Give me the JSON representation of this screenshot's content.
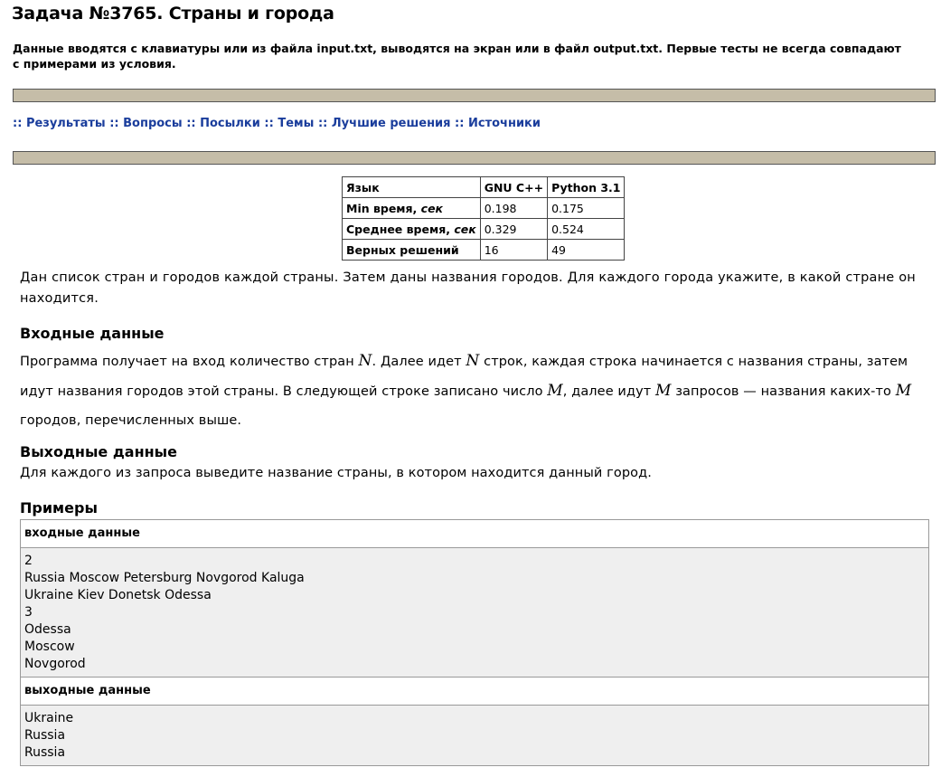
{
  "page": {
    "title": "Задача №3765. Страны и города",
    "note": "Данные вводятся с клавиатуры или из файла input.txt, выводятся на экран или в файл output.txt. Первые тесты не всегда совпадают с примерами из условия."
  },
  "nav": {
    "items": [
      "Результаты",
      "Вопросы",
      "Посылки",
      "Темы",
      "Лучшие решения",
      "Источники"
    ],
    "separator": "::",
    "link_color": "#1a3d9c"
  },
  "stats": {
    "headers": [
      "Язык",
      "GNU C++",
      "Python 3.1"
    ],
    "rows": [
      {
        "label": "Min время,",
        "unit": "сек",
        "values": [
          "0.198",
          "0.175"
        ]
      },
      {
        "label": "Среднее время,",
        "unit": "сек",
        "values": [
          "0.329",
          "0.524"
        ]
      },
      {
        "label": "Верных решений",
        "unit": "",
        "values": [
          "16",
          "49"
        ]
      }
    ]
  },
  "statement": {
    "text": "Дан список стран и городов каждой страны. Затем даны названия городов. Для каждого города укажите, в какой стране он находится."
  },
  "input_section": {
    "title": "Входные данные",
    "p1": "Программа получает на вход количество стран ",
    "v1": "N",
    "p2": ". Далее идет ",
    "v2": "N",
    "p3": " строк, каждая строка начинается с названия страны, затем идут названия городов этой страны. В следующей строке записано число ",
    "v3": "M",
    "p4": ", далее идут ",
    "v4": "M",
    "p5": " запросов — названия каких-то ",
    "v5": "M",
    "p6": " городов, перечисленных выше."
  },
  "output_section": {
    "title": "Выходные данные",
    "text": "Для каждого из запроса выведите название страны, в котором находится данный город."
  },
  "examples": {
    "title": "Примеры",
    "input_label": "входные данные",
    "input_lines": [
      "2",
      "Russia Moscow Petersburg Novgorod Kaluga",
      "Ukraine Kiev Donetsk Odessa",
      "3",
      "Odessa",
      "Moscow",
      "Novgorod"
    ],
    "output_label": "выходные данные",
    "output_lines": [
      "Ukraine",
      "Russia",
      "Russia"
    ]
  }
}
